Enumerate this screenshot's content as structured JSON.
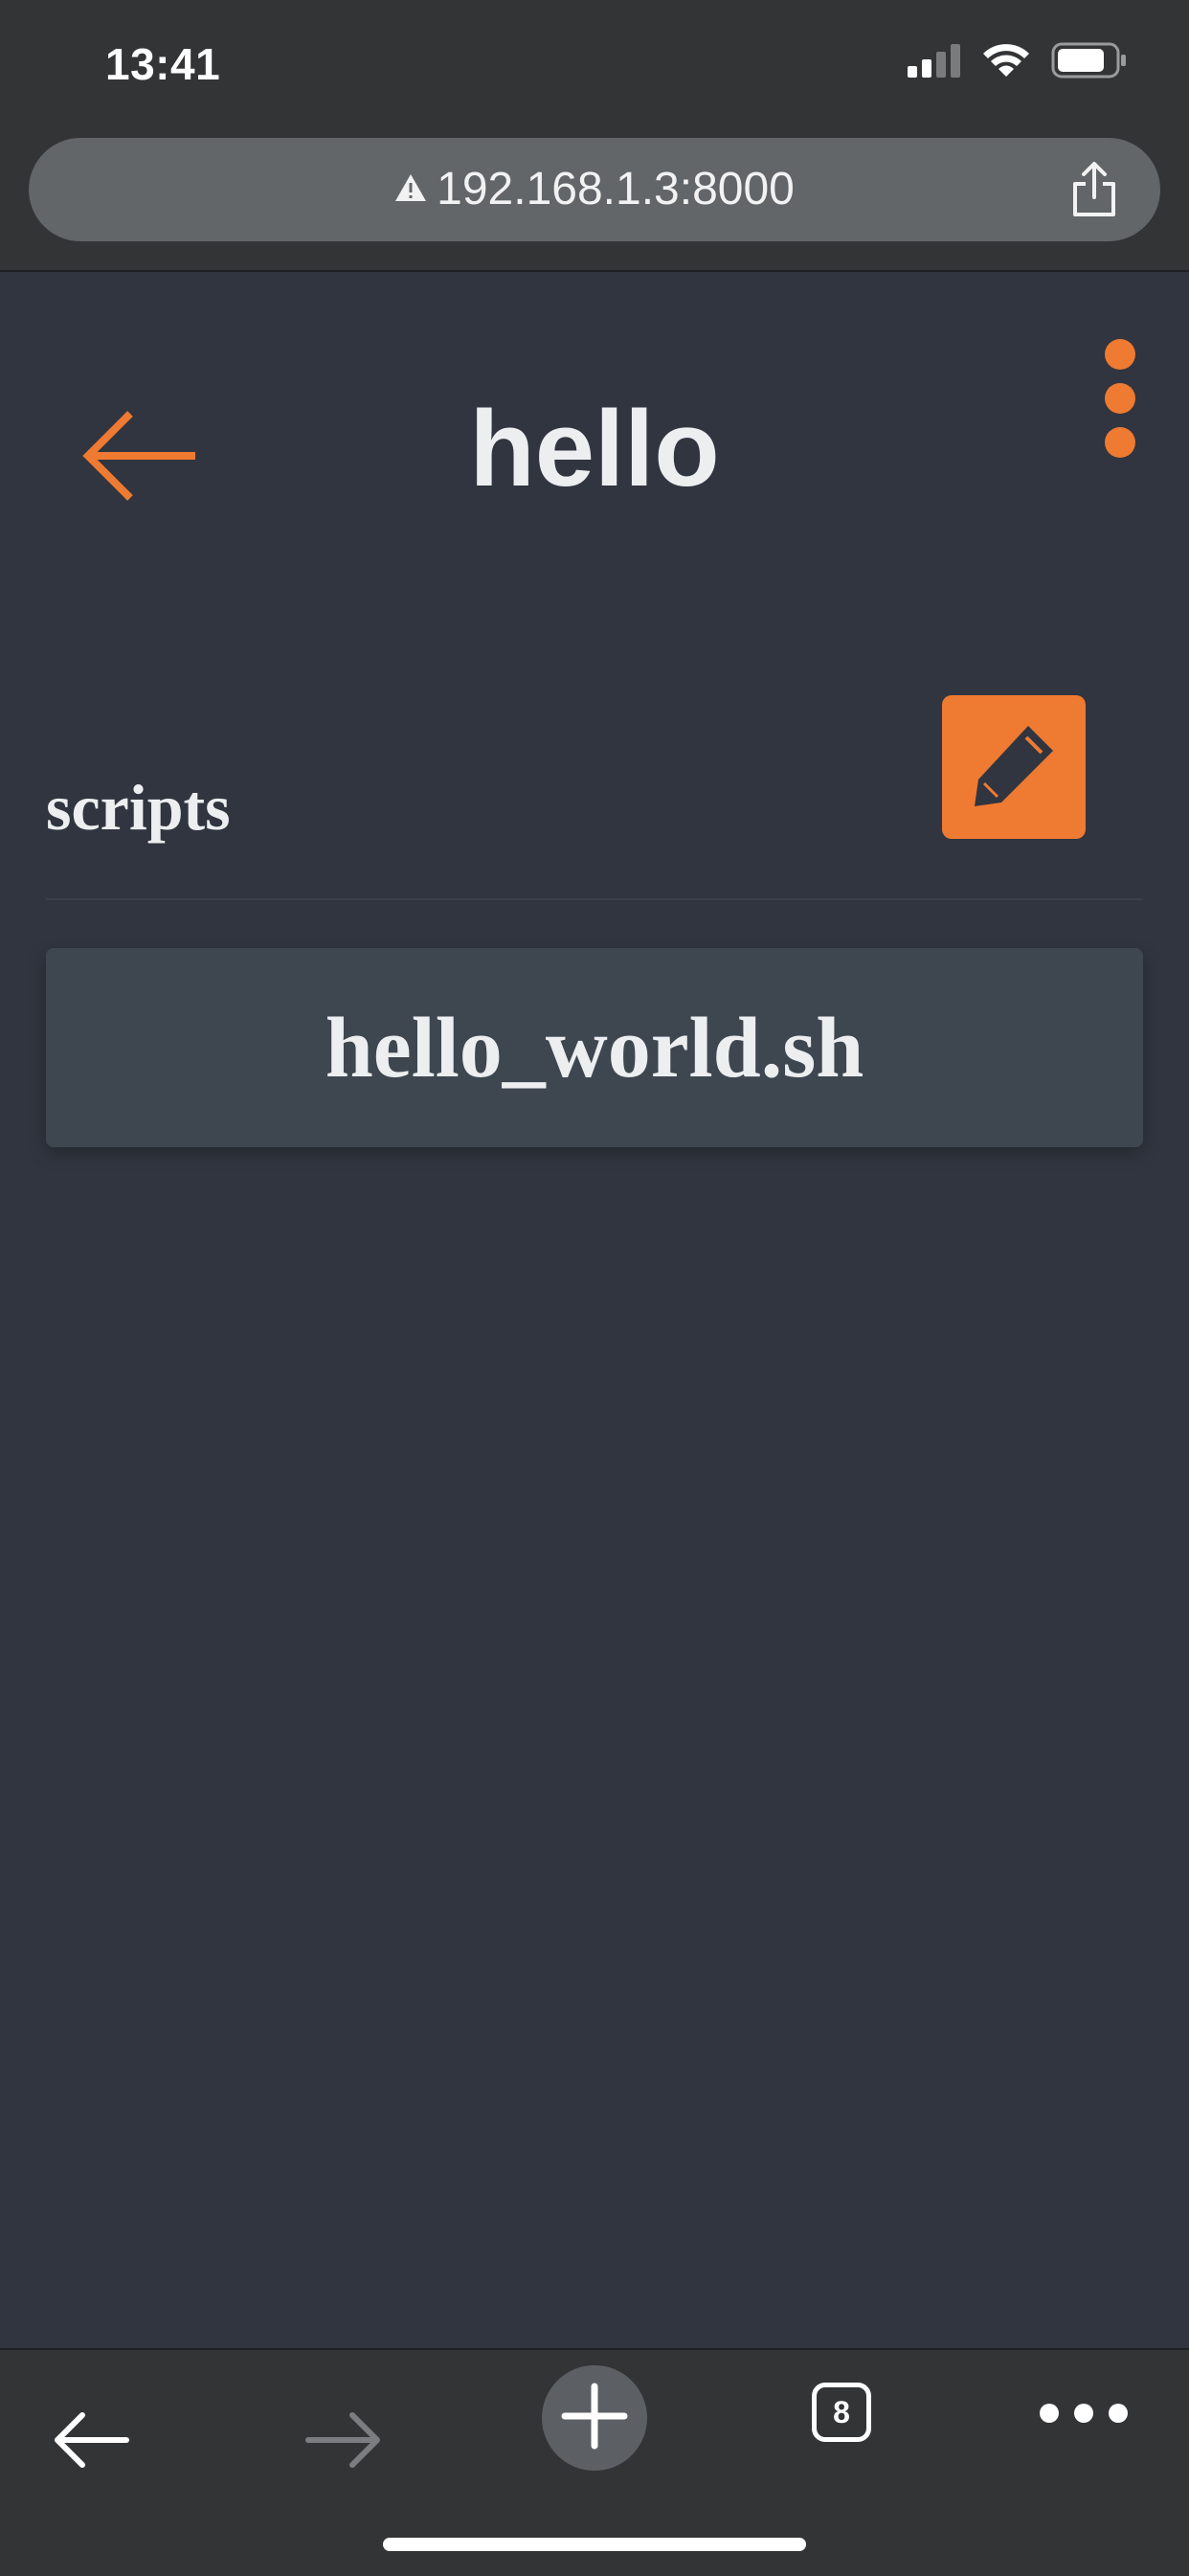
{
  "status_bar": {
    "time": "13:41",
    "signal_icon": "cellular-signal-icon",
    "wifi_icon": "wifi-icon",
    "battery_icon": "battery-icon"
  },
  "browser": {
    "url": "192.168.1.3:8000",
    "security_icon": "warning-icon",
    "share_icon": "share-icon"
  },
  "header": {
    "title": "hello",
    "back_icon": "back-arrow-icon",
    "menu_icon": "kebab-menu-icon"
  },
  "section": {
    "label": "scripts",
    "edit_icon": "pencil-icon"
  },
  "scripts": [
    {
      "name": "hello_world.sh"
    }
  ],
  "toolbar": {
    "tab_count": "8",
    "back_icon": "back-icon",
    "forward_icon": "forward-icon",
    "new_tab_icon": "plus-icon",
    "more_icon": "more-icon"
  },
  "colors": {
    "accent": "#ef7a31",
    "background": "#30353f",
    "card": "#3e4750",
    "browser_chrome": "#333436"
  }
}
